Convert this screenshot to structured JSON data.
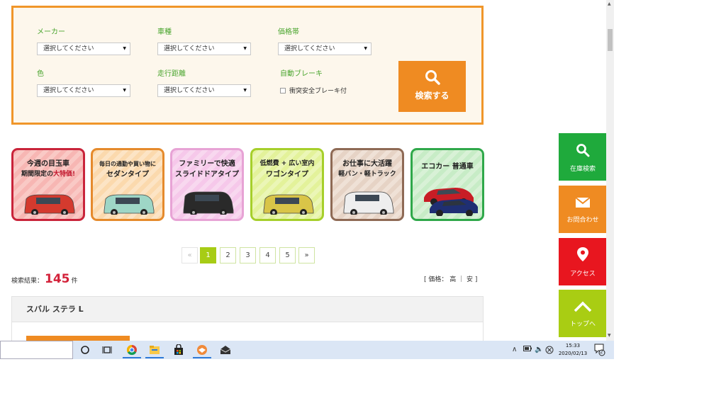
{
  "search": {
    "maker": {
      "label": "メーカー",
      "value": "選択してください"
    },
    "model": {
      "label": "車種",
      "value": "選択してください"
    },
    "price": {
      "label": "価格帯",
      "value": "選択してください"
    },
    "color": {
      "label": "色",
      "value": "選択してください"
    },
    "mileage": {
      "label": "走行距離",
      "value": "選択してください"
    },
    "brake": {
      "label": "自動ブレーキ",
      "checkbox_label": "衝突安全ブレーキ付"
    },
    "button_label": "検索する"
  },
  "categories": [
    {
      "line1": "今週の目玉車",
      "line2a": "期間限定の",
      "line2b": "大特価!",
      "body_color": "#d43a2e"
    },
    {
      "line1": "毎日の通勤や買い物に",
      "line2a": "セダンタイプ",
      "line2b": "",
      "body_color": "#9ed6c6"
    },
    {
      "line1": "ファミリーで快適",
      "line2a": "スライドドアタイプ",
      "line2b": "",
      "body_color": "#2a2a2a"
    },
    {
      "line1": "低燃費 + 広い室内",
      "line2a": "ワゴンタイプ",
      "line2b": "",
      "body_color": "#d9c548"
    },
    {
      "line1": "お仕事に大活躍",
      "line2a": "軽バン・軽トラック",
      "line2b": "",
      "body_color": "#eeeeee"
    },
    {
      "line1": "エコカー 普通車",
      "line2a": "",
      "line2b": "",
      "body_color": "#c81d25"
    }
  ],
  "pagination": {
    "prev": "«",
    "pages": [
      "1",
      "2",
      "3",
      "4",
      "5"
    ],
    "next": "»",
    "current": "1"
  },
  "results": {
    "label": "検索結果：",
    "count": "145",
    "unit": "件"
  },
  "sort": {
    "text": "[ 価格： 高 ｜ 安 ]"
  },
  "listing": {
    "title": "スバル ステラ L"
  },
  "side_buttons": [
    {
      "label": "在庫検索",
      "color": "#1faa3c"
    },
    {
      "label": "お問合わせ",
      "color": "#ef8b22"
    },
    {
      "label": "アクセス",
      "color": "#e8161f"
    },
    {
      "label": "トップへ",
      "color": "#a9cd13"
    }
  ],
  "taskbar": {
    "time": "15:33",
    "date": "2020/02/13",
    "notification_count": "2"
  }
}
